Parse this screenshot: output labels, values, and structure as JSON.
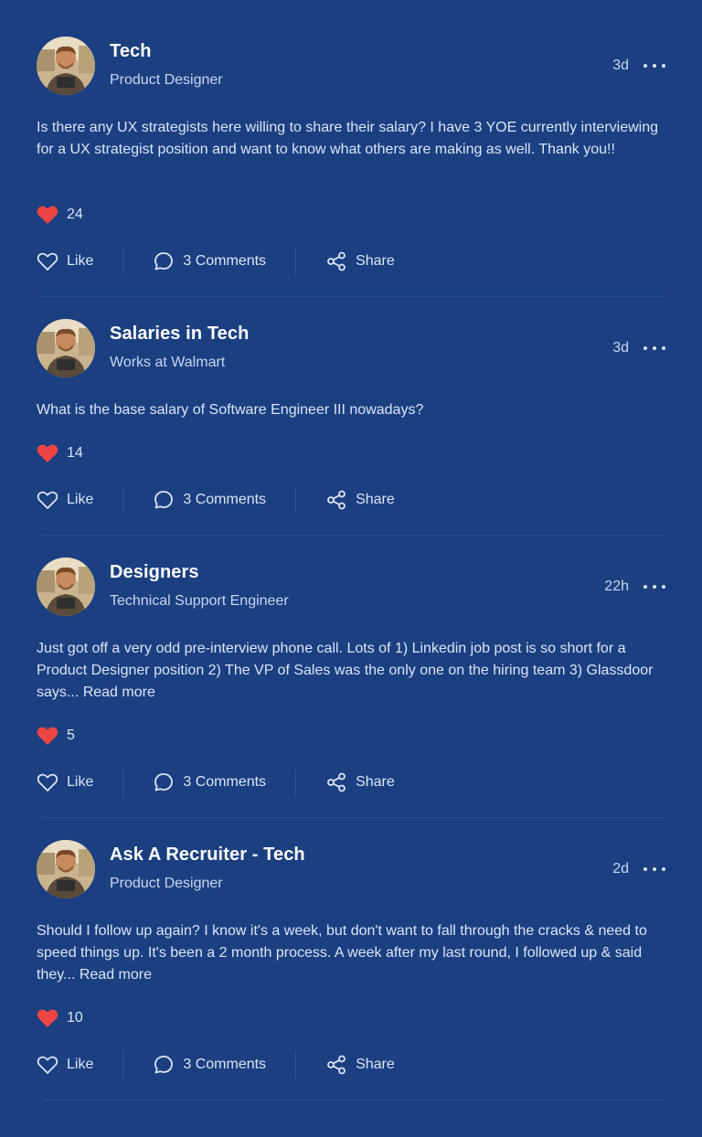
{
  "colors": {
    "background": "#1b3f80",
    "heart": "#ef4444",
    "text_muted": "#c9d6ef"
  },
  "posts": [
    {
      "group": "Tech",
      "subtitle": "Product Designer",
      "time": "3d",
      "text": "Is there any UX strategists here willing to share their salary? I have 3 YOE currently interviewing for a UX strategist position and want to know what others are making as well. Thank you!!",
      "read_more": "",
      "likes": "24",
      "actions": {
        "like": "Like",
        "comments": "3 Comments",
        "share": "Share"
      }
    },
    {
      "group": "Salaries in Tech",
      "subtitle": "Works at Walmart",
      "time": "3d",
      "text": "What is the base salary of Software Engineer III nowadays?",
      "read_more": "",
      "likes": "14",
      "actions": {
        "like": "Like",
        "comments": "3 Comments",
        "share": "Share"
      }
    },
    {
      "group": "Designers",
      "subtitle": "Technical Support Engineer",
      "time": "22h",
      "text": "Just got off a very odd pre-interview phone call. Lots of 1) Linkedin job post is so short for a Product Designer position 2) The VP of Sales was the only one on the hiring team 3) Glassdoor says...",
      "read_more": "Read more",
      "likes": "5",
      "actions": {
        "like": "Like",
        "comments": "3 Comments",
        "share": "Share"
      }
    },
    {
      "group": "Ask A Recruiter - Tech",
      "subtitle": "Product Designer",
      "time": "2d",
      "text": "Should I follow up again? I know it's a week, but don't want to fall through the cracks & need to speed things up. It's been a 2 month process. A week after my last round, I followed up & said they...",
      "read_more": "Read more",
      "likes": "10",
      "actions": {
        "like": "Like",
        "comments": "3 Comments",
        "share": "Share"
      }
    }
  ]
}
